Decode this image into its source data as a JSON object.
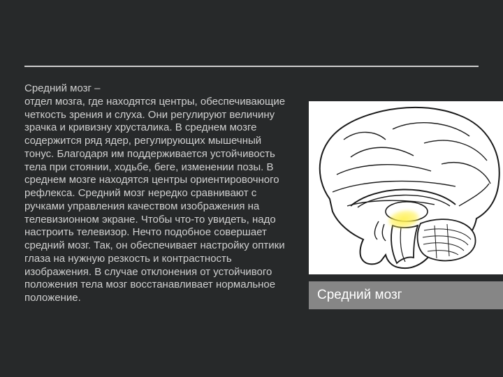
{
  "slide": {
    "title": "Средний мозг –",
    "body": "отдел мозга, где находятся центры, обеспечивающие четкость зрения и слуха. Они регулируют величину зрачка и кривизну хрусталика. В среднем мозге содержится ряд ядер, регулирующих мышечный тонус. Благодаря им поддерживается устойчивость тела при стоянии, ходьбе, беге, изменении позы. В среднем мозге находятся центры ориентировочного рефлекса. Средний мозг нередко сравнивают с ручками управления качеством изображения на телевизионном экране. Чтобы что-то увидеть, надо настроить телевизор. Нечто подобное совершает средний мозг. Так, он обеспечивает настройку оптики глаза на нужную резкость и контрастность изображения. В случае отклонения от устойчивого положения тела мозг восстанавливает нормальное положение.",
    "caption": "Средний мозг"
  }
}
